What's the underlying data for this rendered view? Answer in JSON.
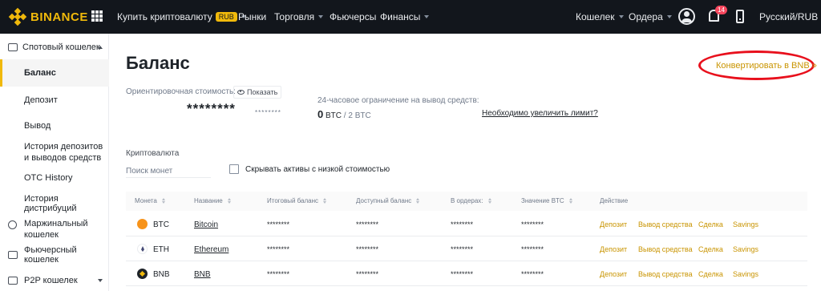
{
  "header": {
    "logo": "BINANCE",
    "nav_left": [
      {
        "label": "Купить криптовалюту",
        "badge": "RUB"
      },
      {
        "label": "Рынки"
      },
      {
        "label": "Торговля"
      },
      {
        "label": "Фьючерсы"
      },
      {
        "label": "Финансы"
      }
    ],
    "nav_right": {
      "wallet": "Кошелек",
      "orders": "Ордера",
      "notifications": "14",
      "language": "Русский/RUB"
    }
  },
  "sidebar": {
    "items": [
      {
        "label": "Спотовый кошелек"
      },
      {
        "label": "Баланс"
      },
      {
        "label": "Депозит"
      },
      {
        "label": "Вывод"
      },
      {
        "label": "История депозитов и выводов средств"
      },
      {
        "label": "OTC History"
      },
      {
        "label": "История дистрибуций"
      },
      {
        "label": "Маржинальный кошелек"
      },
      {
        "label": "Фьючерсный кошелек"
      },
      {
        "label": "P2P кошелек"
      }
    ]
  },
  "main": {
    "title": "Баланс",
    "convert_link": "Конвертировать в BNB »",
    "estimated_label": "Ориентировочная стоимость:",
    "show_button": "Показать",
    "masked_big": "********",
    "masked_small": "********",
    "limit_label": "24-часовое ограничение на вывод средств:",
    "limit_used": "0",
    "limit_unit": "BTC",
    "limit_total": "/ 2 BTC",
    "increase_link": "Необходимо увеличить лимит?",
    "crypto_label": "Криптовалюта",
    "search_placeholder": "Поиск монет",
    "hide_small_label": "Скрывать активы с низкой стоимостью"
  },
  "table": {
    "headers": {
      "coin": "Монета",
      "name": "Название",
      "total": "Итоговый баланс",
      "available": "Доступный баланс",
      "in_order": "В ордерах:",
      "btc_value": "Значение BTC",
      "action": "Действие"
    },
    "actions": {
      "deposit": "Депозит",
      "withdraw": "Вывод средства",
      "trade": "Сделка",
      "savings": "Savings"
    },
    "rows": [
      {
        "coin": "BTC",
        "name": "Bitcoin",
        "total": "********",
        "available": "********",
        "in_order": "********",
        "btc_value": "********"
      },
      {
        "coin": "ETH",
        "name": "Ethereum",
        "total": "********",
        "available": "********",
        "in_order": "********",
        "btc_value": "********"
      },
      {
        "coin": "BNB",
        "name": "BNB",
        "total": "********",
        "available": "********",
        "in_order": "********",
        "btc_value": "********"
      }
    ]
  },
  "colors": {
    "brand_yellow": "#f0b90b",
    "link_gold": "#c99400",
    "topbar": "#12161c",
    "highlight_red": "#e8101c"
  }
}
